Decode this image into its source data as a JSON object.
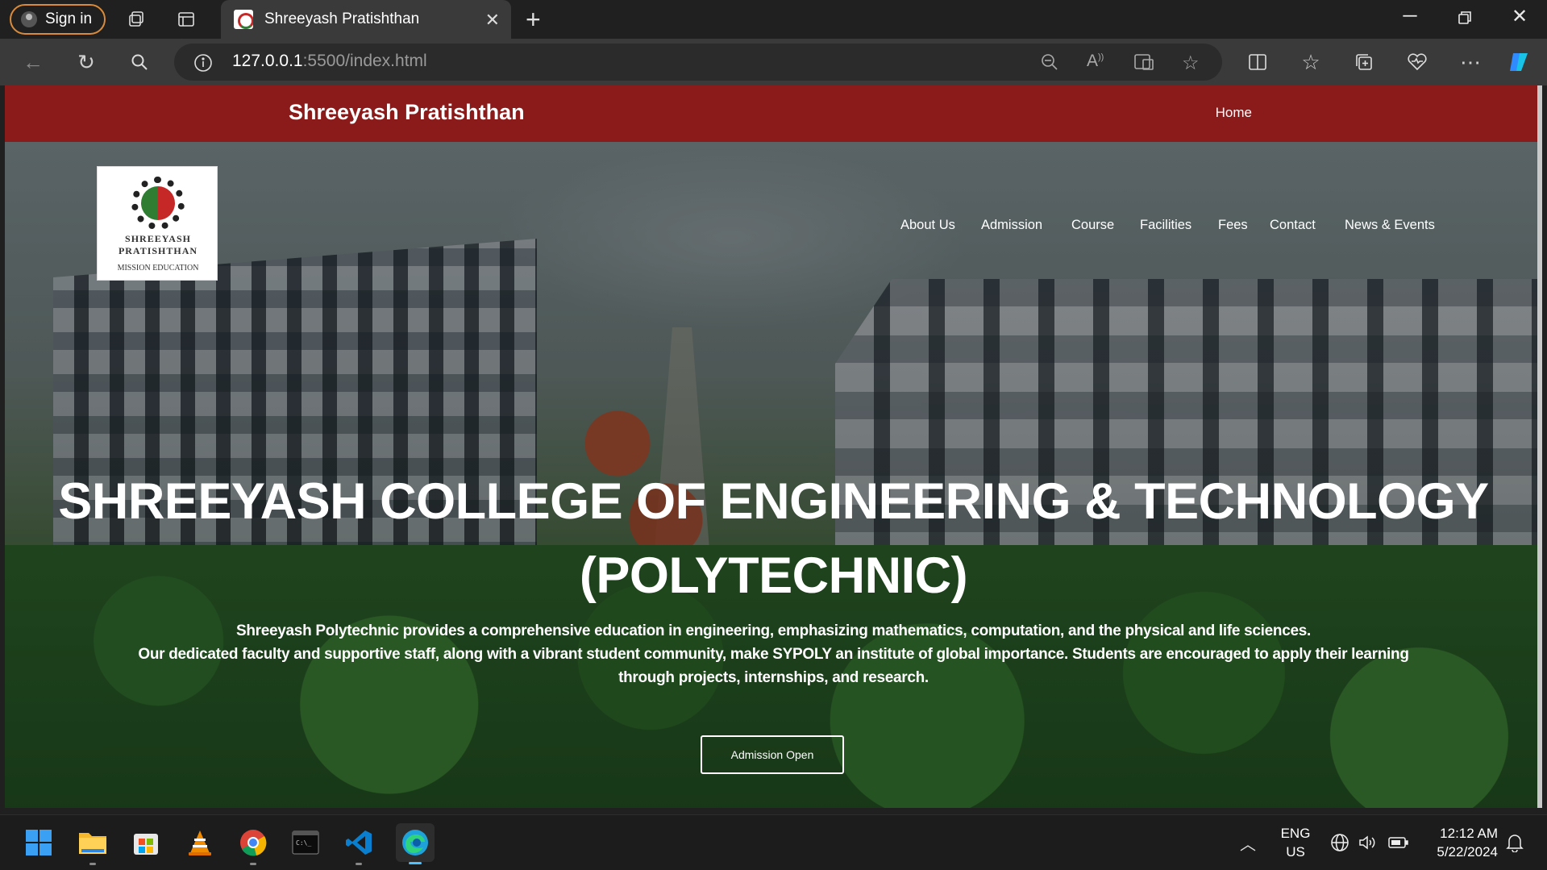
{
  "browser": {
    "signin_label": "Sign in",
    "tab_title": "Shreeyash Pratishthan",
    "url_host": "127.0.0.1",
    "url_rest": ":5500/index.html"
  },
  "site": {
    "brand": "Shreeyash Pratishthan",
    "home_link": "Home",
    "logo": {
      "text_top": "SHREEYASH PRATISHTHAN",
      "text_bottom": "MISSION EDUCATION"
    },
    "menu": [
      "About Us",
      "Admission",
      "Course",
      "Facilities",
      "Fees",
      "Contact",
      "News & Events"
    ],
    "hero": {
      "title_line1": "SHREEYASH COLLEGE OF ENGINEERING & TECHNOLOGY",
      "title_line2": "(POLYTECHNIC)",
      "desc_line1": "Shreeyash Polytechnic provides a comprehensive education in engineering, emphasizing mathematics, computation, and the physical and life sciences.",
      "desc_line2": "Our dedicated faculty and supportive staff, along with a vibrant student community, make SYPOLY an institute of global importance. Students are encouraged to apply their learning",
      "desc_line3": "through projects, internships, and research.",
      "cta": "Admission Open"
    },
    "colors": {
      "header": "#8b1a1a",
      "accent_border": "#d98b3a"
    }
  },
  "taskbar": {
    "lang_top": "ENG",
    "lang_bottom": "US",
    "time": "12:12 AM",
    "date": "5/22/2024",
    "apps": [
      "start-icon",
      "file-explorer-icon",
      "store-icon",
      "vlc-icon",
      "chrome-icon",
      "terminal-icon",
      "vscode-icon",
      "edge-icon"
    ]
  }
}
